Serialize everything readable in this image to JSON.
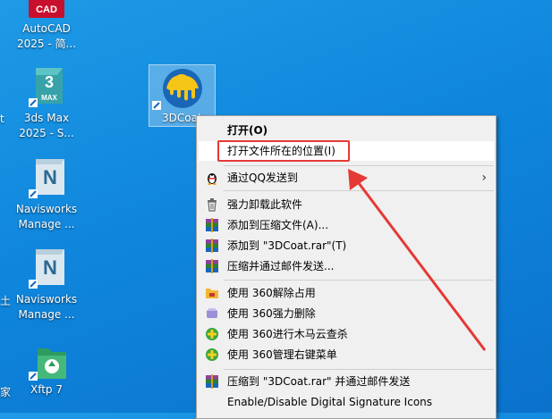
{
  "desktop_icons": [
    {
      "label_lines": [
        "AutoCAD",
        "2025 - 简..."
      ],
      "icon": "autocad-icon",
      "badge": "CAD"
    },
    {
      "label_lines": [
        "3ds Max",
        "2025 - S..."
      ],
      "icon": "3dsmax-icon",
      "badge": "3",
      "sub": "MAX"
    },
    {
      "label_lines": [
        "Navisworks",
        "Manage ..."
      ],
      "icon": "navisworks-icon",
      "badge": "N"
    },
    {
      "label_lines": [
        "Navisworks",
        "Manage ..."
      ],
      "icon": "navisworks-icon",
      "badge": "N"
    },
    {
      "label_lines": [
        "Xftp 7"
      ],
      "icon": "xftp-icon"
    }
  ],
  "edge_chars": [
    "t",
    "土",
    "家"
  ],
  "selected_icon_label": "3DCoat",
  "context_menu": {
    "items": [
      {
        "label": "打开(O)",
        "icon": "",
        "bold": true
      },
      {
        "label": "打开文件所在的位置(I)",
        "icon": "",
        "highlight": true
      },
      {
        "label": "通过QQ发送到",
        "icon": "qq-penguin-icon",
        "submenu": true
      },
      {
        "label": "强力卸载此软件",
        "icon": "trash-icon"
      },
      {
        "label": "添加到压缩文件(A)...",
        "icon": "winrar-icon"
      },
      {
        "label": "添加到 \"3DCoat.rar\"(T)",
        "icon": "winrar-icon"
      },
      {
        "label": "压缩并通过邮件发送...",
        "icon": "winrar-icon"
      },
      {
        "label": "使用 360解除占用",
        "icon": "360-unlock-icon"
      },
      {
        "label": "使用 360强力删除",
        "icon": "360-delete-icon"
      },
      {
        "label": "使用 360进行木马云查杀",
        "icon": "360-scan-icon"
      },
      {
        "label": "使用 360管理右键菜单",
        "icon": "360-manage-icon"
      },
      {
        "label": "压缩到 \"3DCoat.rar\" 并通过邮件发送",
        "icon": "winrar-icon"
      },
      {
        "label": "Enable/Disable Digital Signature Icons",
        "icon": ""
      }
    ],
    "submenu_arrow": "›"
  },
  "colors": {
    "desktop": "#0f86dc",
    "menu_bg": "#f0f0f0",
    "annotation": "#e53935"
  }
}
